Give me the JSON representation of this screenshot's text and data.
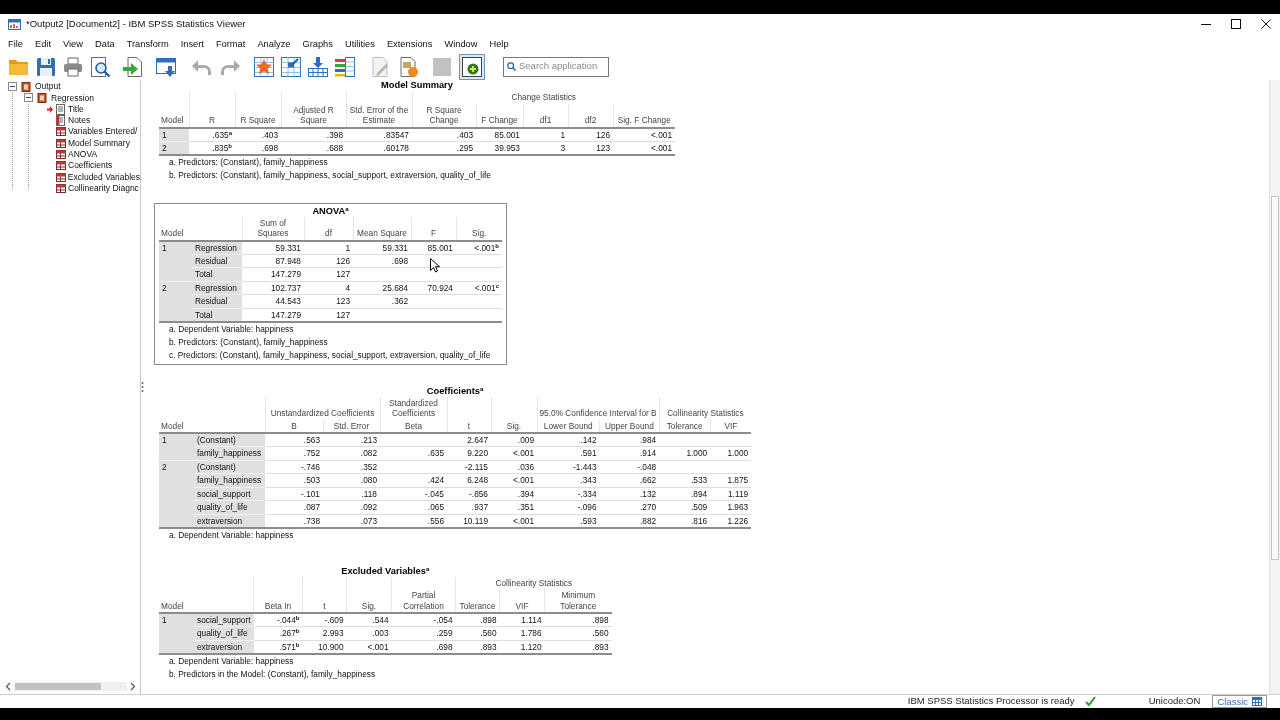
{
  "window": {
    "title": "*Output2 [Document2] - IBM SPSS Statistics Viewer"
  },
  "menu": [
    "File",
    "Edit",
    "View",
    "Data",
    "Transform",
    "Insert",
    "Format",
    "Analyze",
    "Graphs",
    "Utilities",
    "Extensions",
    "Window",
    "Help"
  ],
  "toolbar": {
    "buttons": [
      {
        "disabled": false,
        "pressed": false
      },
      {
        "disabled": false,
        "pressed": false
      },
      {
        "disabled": false,
        "pressed": false
      },
      {
        "disabled": false,
        "pressed": false
      },
      {
        "disabled": false,
        "pressed": false
      },
      {
        "disabled": false,
        "pressed": false
      },
      {
        "disabled": true,
        "pressed": false
      },
      {
        "disabled": true,
        "pressed": false
      },
      {
        "disabled": false,
        "pressed": false
      },
      {
        "disabled": false,
        "pressed": false
      },
      {
        "disabled": false,
        "pressed": false
      },
      {
        "disabled": false,
        "pressed": false
      },
      {
        "disabled": true,
        "pressed": false
      },
      {
        "disabled": false,
        "pressed": false
      },
      {
        "disabled": true,
        "pressed": false
      },
      {
        "disabled": false,
        "pressed": true
      }
    ],
    "search": {
      "placeholder": "Search application"
    }
  },
  "tree": [
    {
      "label": "Output",
      "expanded": true,
      "children": [
        {
          "label": "Regression",
          "expanded": true,
          "children": [
            {
              "label": "Title",
              "kind": "title",
              "current": true
            },
            {
              "label": "Notes",
              "kind": "notes",
              "current": false
            },
            {
              "label": "Variables Entered/",
              "kind": "table",
              "current": false
            },
            {
              "label": "Model Summary",
              "kind": "table",
              "current": false
            },
            {
              "label": "ANOVA",
              "kind": "table",
              "current": false
            },
            {
              "label": "Coefficients",
              "kind": "table",
              "current": false
            },
            {
              "label": "Excluded Variables",
              "kind": "table",
              "current": false
            },
            {
              "label": "Collinearity Diagnc",
              "kind": "table",
              "current": false
            }
          ]
        }
      ]
    }
  ],
  "output_items": [
    {
      "title": "Model Summary",
      "selected": false,
      "header": [
        {
          "kind": "stub",
          "label": "Model"
        },
        {
          "kind": "column",
          "label": "R"
        },
        {
          "kind": "column",
          "label": "R Square"
        },
        {
          "kind": "column",
          "label": "Adjusted R Square"
        },
        {
          "kind": "column",
          "label": "Std. Error of the Estimate"
        },
        {
          "kind": "group",
          "label": "Change Statistics",
          "columns": [
            "R Square Change",
            "F Change",
            "df1",
            "df2",
            "Sig. F Change"
          ]
        }
      ],
      "body": [
        {
          "model": "1",
          "cells": [
            ".635$^{a}$",
            ".403",
            ".398",
            ".83547",
            ".403",
            "85.001",
            "1",
            "126",
            "<.001"
          ]
        },
        {
          "model": "2",
          "cells": [
            ".835$^{b}$",
            ".698",
            ".688",
            ".60178",
            ".295",
            "39.953",
            "3",
            "123",
            "<.001"
          ]
        }
      ],
      "footnotes": [
        "a. Predictors: (Constant), family_happiness",
        "b. Predictors: (Constant), family_happiness, social_support, extraversion, quality_of_life"
      ]
    },
    {
      "title": "ANOVA$^{a}$",
      "selected": true,
      "header": [
        {
          "kind": "stub",
          "label": "Model"
        },
        {
          "kind": "column",
          "label": "Sum of Squares"
        },
        {
          "kind": "column",
          "label": "df"
        },
        {
          "kind": "column",
          "label": "Mean Square"
        },
        {
          "kind": "column",
          "label": "F"
        },
        {
          "kind": "column",
          "label": "Sig."
        }
      ],
      "body": [
        {
          "model": "1",
          "rows": [
            {
              "label": "Regression",
              "cells": [
                "59.331",
                "1",
                "59.331",
                "85.001",
                "<.001$^{b}$"
              ]
            },
            {
              "label": "Residual",
              "cells": [
                "87.948",
                "126",
                ".698",
                null,
                null
              ]
            },
            {
              "label": "Total",
              "cells": [
                "147.279",
                "127",
                null,
                null,
                null
              ]
            }
          ]
        },
        {
          "model": "2",
          "rows": [
            {
              "label": "Regression",
              "cells": [
                "102.737",
                "4",
                "25.684",
                "70.924",
                "<.001$^{c}$"
              ]
            },
            {
              "label": "Residual",
              "cells": [
                "44.543",
                "123",
                ".362",
                null,
                null
              ]
            },
            {
              "label": "Total",
              "cells": [
                "147.279",
                "127",
                null,
                null,
                null
              ]
            }
          ]
        }
      ],
      "footnotes": [
        "a. Dependent Variable: happiness",
        "b. Predictors: (Constant), family_happiness",
        "c. Predictors: (Constant), family_happiness, social_support, extraversion, quality_of_life"
      ]
    },
    {
      "title": "Coefficients$^{a}$",
      "selected": false,
      "header": [
        {
          "kind": "stub",
          "label": "Model"
        },
        {
          "kind": "group",
          "label": "Unstandardized Coefficients",
          "columns": [
            "B",
            "Std. Error"
          ]
        },
        {
          "kind": "group",
          "label": "Standardized Coefficients",
          "columns": [
            "Beta"
          ]
        },
        {
          "kind": "column",
          "label": "t"
        },
        {
          "kind": "column",
          "label": "Sig."
        },
        {
          "kind": "group",
          "label": "95.0% Confidence Interval for B",
          "columns": [
            "Lower Bound",
            "Upper Bound"
          ]
        },
        {
          "kind": "group",
          "label": "Collinearity Statistics",
          "columns": [
            "Tolerance",
            "VIF"
          ]
        }
      ],
      "body": [
        {
          "model": "1",
          "rows": [
            {
              "label": "(Constant)",
              "cells": [
                ".563",
                ".213",
                null,
                "2.647",
                ".009",
                ".142",
                ".984",
                null,
                null
              ]
            },
            {
              "label": "family_happiness",
              "cells": [
                ".752",
                ".082",
                ".635",
                "9.220",
                "<.001",
                ".591",
                ".914",
                "1.000",
                "1.000"
              ]
            }
          ]
        },
        {
          "model": "2",
          "rows": [
            {
              "label": "(Constant)",
              "cells": [
                "-.746",
                ".352",
                null,
                "-2.115",
                ".036",
                "-1.443",
                "-.048",
                null,
                null
              ]
            },
            {
              "label": "family_happiness",
              "cells": [
                ".503",
                ".080",
                ".424",
                "6.248",
                "<.001",
                ".343",
                ".662",
                ".533",
                "1.875"
              ]
            },
            {
              "label": "social_support",
              "cells": [
                "-.101",
                ".118",
                "-.045",
                "-.856",
                ".394",
                "-.334",
                ".132",
                ".894",
                "1.119"
              ]
            },
            {
              "label": "quality_of_life",
              "cells": [
                ".087",
                ".092",
                ".065",
                ".937",
                ".351",
                "-.096",
                ".270",
                ".509",
                "1.963"
              ]
            },
            {
              "label": "extraversion",
              "cells": [
                ".738",
                ".073",
                ".556",
                "10.119",
                "<.001",
                ".593",
                ".882",
                ".816",
                "1.226"
              ]
            }
          ]
        }
      ],
      "footnotes": [
        "a. Dependent Variable: happiness"
      ]
    },
    {
      "title": "Excluded Variables$^{a}$",
      "selected": false,
      "header": [
        {
          "kind": "stub",
          "label": "Model"
        },
        {
          "kind": "column",
          "label": "Beta In"
        },
        {
          "kind": "column",
          "label": "t"
        },
        {
          "kind": "column",
          "label": "Sig."
        },
        {
          "kind": "column",
          "label": "Partial Correlation"
        },
        {
          "kind": "group",
          "label": "Collinearity Statistics",
          "columns": [
            "Tolerance",
            "VIF",
            "Minimum Tolerance"
          ]
        }
      ],
      "body": [
        {
          "model": "1",
          "rows": [
            {
              "label": "social_support",
              "cells": [
                "-.044$^{b}$",
                "-.609",
                ".544",
                "-.054",
                ".898",
                "1.114",
                ".898"
              ]
            },
            {
              "label": "quality_of_life",
              "cells": [
                ".267$^{b}$",
                "2.993",
                ".003",
                ".259",
                ".560",
                "1.786",
                ".560"
              ]
            },
            {
              "label": "extraversion",
              "cells": [
                ".571$^{b}$",
                "10.900",
                "<.001",
                ".698",
                ".893",
                "1.120",
                ".893"
              ]
            }
          ]
        }
      ],
      "footnotes": [
        "a. Dependent Variable: happiness",
        "b. Predictors in the Model: (Constant), family_happiness"
      ]
    }
  ],
  "status_bar": {
    "message": "IBM SPSS Statistics Processor is ready",
    "encoding": "Unicode:ON",
    "view_button": "Classic"
  }
}
